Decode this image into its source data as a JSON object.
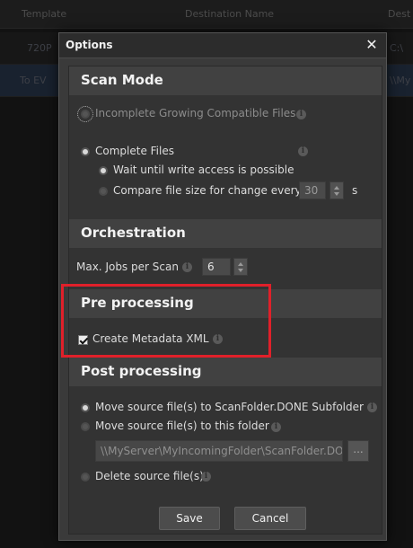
{
  "background": {
    "columns": [
      "Template",
      "Destination Name",
      "Dest"
    ],
    "rows": [
      {
        "template": "720P",
        "dest": "C:\\"
      },
      {
        "template": "To EV",
        "dest": "\\\\My"
      }
    ]
  },
  "dialog": {
    "title": "Options",
    "close_glyph": "✕",
    "scan_mode": {
      "heading": "Scan Mode",
      "incomplete_label": "Incomplete Growing Compatible Files",
      "complete_label": "Complete Files",
      "wait_label": "Wait until write access is possible",
      "compare_label": "Compare file size for change every",
      "compare_value": "30",
      "compare_unit": "s"
    },
    "orchestration": {
      "heading": "Orchestration",
      "max_jobs_label": "Max. Jobs per Scan",
      "max_jobs_value": "6"
    },
    "pre_processing": {
      "heading": "Pre processing",
      "create_metadata_label": "Create Metadata XML"
    },
    "post_processing": {
      "heading": "Post processing",
      "move_done_label": "Move source file(s) to ScanFolder.DONE Subfolder",
      "move_folder_label": "Move source file(s) to this folder",
      "folder_path": "\\\\MyServer\\MyIncomingFolder\\ScanFolder.DONE",
      "browse_label": "...",
      "delete_label": "Delete source file(s)"
    },
    "buttons": {
      "save": "Save",
      "cancel": "Cancel"
    }
  },
  "colors": {
    "highlight": "#e0202a",
    "dialog_bg": "#3a3a3a",
    "section_bg": "#414141"
  },
  "icons": {
    "info": "info-icon",
    "close": "close-icon"
  }
}
